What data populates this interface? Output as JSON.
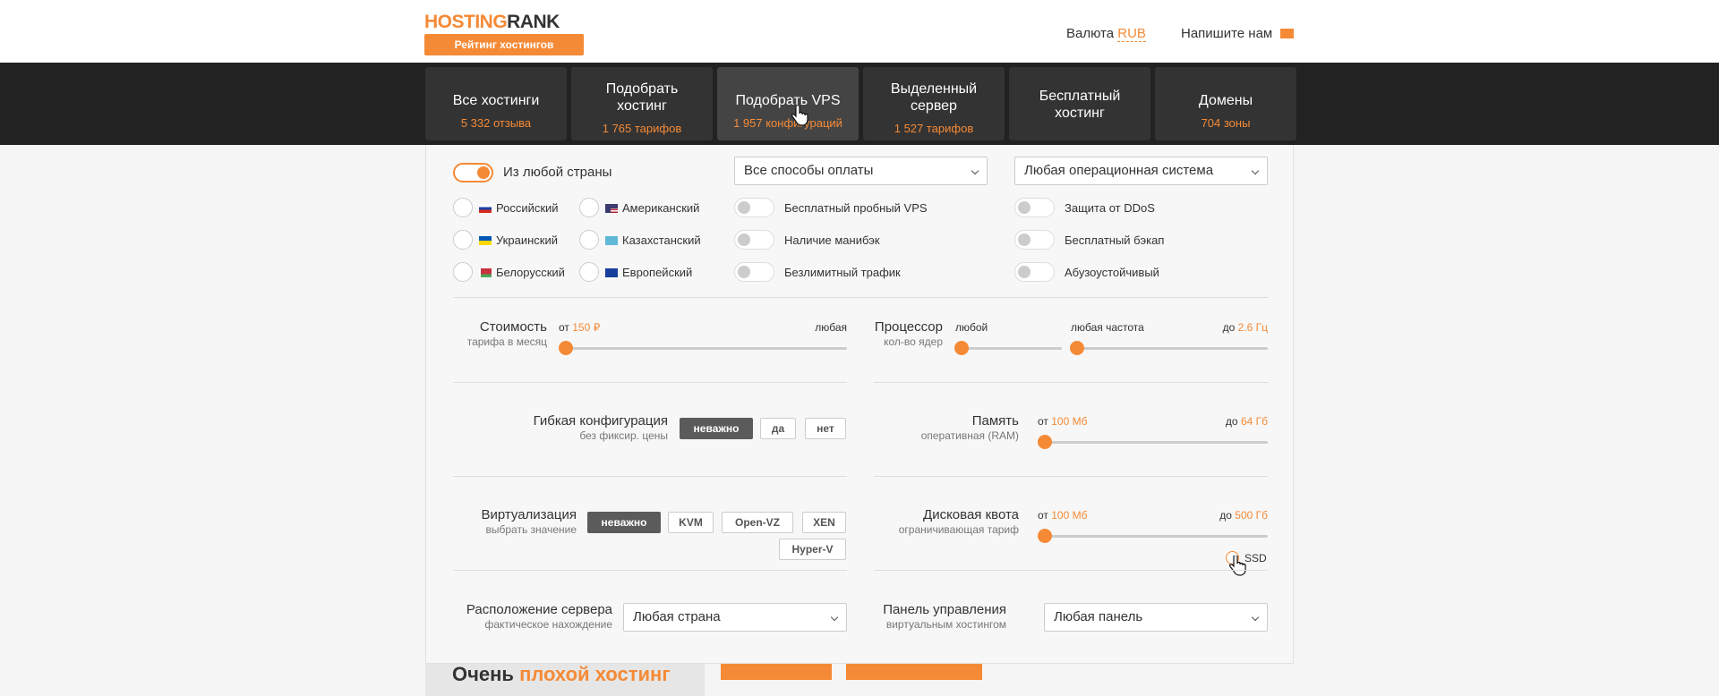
{
  "header": {
    "logo_hosting": "HOSTING",
    "logo_rank": "RANK",
    "logo_tagline": "Рейтинг хостингов",
    "currency_label": "Валюта",
    "currency_value": "RUB",
    "contact_label": "Напишите нам",
    "contact_icon": "envelope-icon"
  },
  "nav": [
    {
      "title": "Все хостинги",
      "sub": "5 332 отзыва"
    },
    {
      "title": "Подобрать хостинг",
      "sub": "1 765 тарифов"
    },
    {
      "title": "Подобрать VPS",
      "sub": "1 957 конфигураций"
    },
    {
      "title": "Выделенный сервер",
      "sub": "1 527 тарифов"
    },
    {
      "title": "Бесплатный хостинг",
      "sub": ""
    },
    {
      "title": "Домены",
      "sub": "704 зоны"
    }
  ],
  "filters": {
    "any_country": "Из любой страны",
    "payment_select": "Все способы оплаты",
    "os_select": "Любая операционная система",
    "countries": [
      {
        "label": "Российский",
        "flag": "flag-ru"
      },
      {
        "label": "Американский",
        "flag": "flag-us"
      },
      {
        "label": "Украинский",
        "flag": "flag-ua"
      },
      {
        "label": "Казахстанский",
        "flag": "flag-kz"
      },
      {
        "label": "Белорусский",
        "flag": "flag-by"
      },
      {
        "label": "Европейский",
        "flag": "flag-eu"
      }
    ],
    "toggles_mid": [
      "Бесплатный пробный VPS",
      "Наличие манибэк",
      "Безлимитный трафик"
    ],
    "toggles_right": [
      "Защита от DDoS",
      "Бесплатный бэкап",
      "Абузоустойчивый"
    ],
    "cost": {
      "label": "Стоимость",
      "sub": "тарифа в месяц",
      "from_label": "от",
      "from_value": "150 ₽",
      "to_label": "любая"
    },
    "cpu": {
      "label": "Процессор",
      "sub": "кол-во ядер",
      "cores_value": "любой",
      "freq_label": "любая частота",
      "to_label": "до",
      "to_value": "2.6 Гц"
    },
    "flex": {
      "label": "Гибкая конфигурация",
      "sub": "без фиксир. цены",
      "options": [
        "неважно",
        "да",
        "нет"
      ],
      "selected": "неважно"
    },
    "memory": {
      "label": "Память",
      "sub": "оперативная (RAM)",
      "from_label": "от",
      "from_value": "100 Мб",
      "to_label": "до",
      "to_value": "64 Гб"
    },
    "virt": {
      "label": "Виртуализация",
      "sub": "выбрать значение",
      "options": [
        "неважно",
        "KVM",
        "Open-VZ",
        "XEN",
        "Hyper-V"
      ],
      "selected": "неважно"
    },
    "disk": {
      "label": "Дисковая квота",
      "sub": "ограничивающая тариф",
      "from_label": "от",
      "from_value": "100 Мб",
      "to_label": "до",
      "to_value": "500 Гб",
      "ssd_label": "SSD"
    },
    "location": {
      "label": "Расположение сервера",
      "sub": "фактическое нахождение",
      "select": "Любая страна"
    },
    "panel": {
      "label": "Панель управления",
      "sub": "виртуальным хостингом",
      "select": "Любая панель"
    }
  },
  "bottom": {
    "title_prefix": "Очень",
    "title_accent": "плохой хостинг"
  },
  "colors": {
    "accent": "#f58a36",
    "nav_bg": "#222222",
    "selected_btn": "#5b5b5b"
  }
}
